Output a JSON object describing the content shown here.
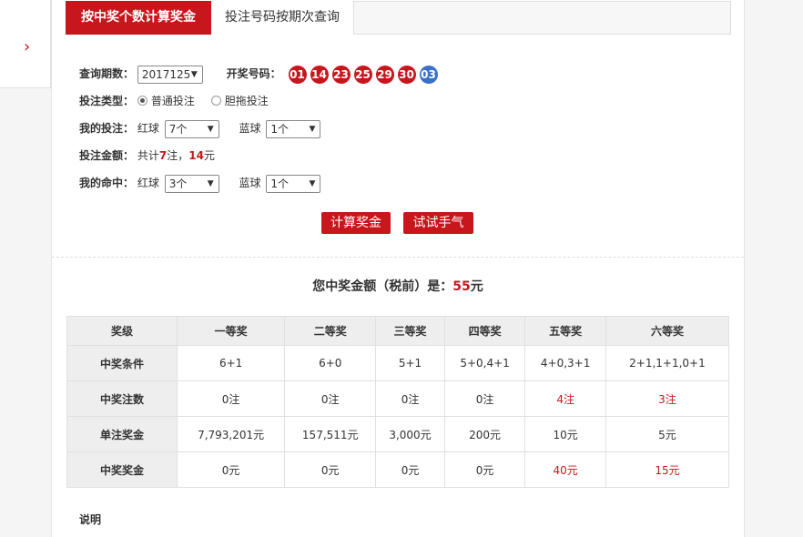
{
  "tabs": {
    "active": "按中奖个数计算奖金",
    "inactive": "投注号码按期次查询"
  },
  "query": {
    "period_label": "查询期数：",
    "period_value": "2017125",
    "winning_label": "开奖号码：",
    "red_balls": [
      "01",
      "14",
      "23",
      "25",
      "29",
      "30"
    ],
    "blue_balls": [
      "03"
    ]
  },
  "bet_type": {
    "label": "投注类型：",
    "options": [
      "普通投注",
      "胆拖投注"
    ],
    "selected": "普通投注"
  },
  "my_bet": {
    "label": "我的投注：",
    "red_label": "红球",
    "red_value": "7个",
    "blue_label": "蓝球",
    "blue_value": "1个"
  },
  "amount": {
    "label": "投注金额：",
    "prefix": "共计",
    "count": "7",
    "mid": "注，",
    "money": "14",
    "suffix": "元"
  },
  "my_hit": {
    "label": "我的命中：",
    "red_label": "红球",
    "red_value": "3个",
    "blue_label": "蓝球",
    "blue_value": "1个"
  },
  "buttons": {
    "calculate": "计算奖金",
    "luck": "试试手气"
  },
  "result": {
    "prefix": "您中奖金额（税前）是：",
    "amount": "55",
    "suffix": "元"
  },
  "table": {
    "headers": [
      "奖级",
      "一等奖",
      "二等奖",
      "三等奖",
      "四等奖",
      "五等奖",
      "六等奖"
    ],
    "rows": [
      {
        "label": "中奖条件",
        "cells": [
          "6+1",
          "6+0",
          "5+1",
          "5+0,4+1",
          "4+0,3+1",
          "2+1,1+1,0+1"
        ],
        "highlight": [
          false,
          false,
          false,
          false,
          false,
          false
        ]
      },
      {
        "label": "中奖注数",
        "cells": [
          "0注",
          "0注",
          "0注",
          "0注",
          "4注",
          "3注"
        ],
        "highlight": [
          false,
          false,
          false,
          false,
          true,
          true
        ]
      },
      {
        "label": "单注奖金",
        "cells": [
          "7,793,201元",
          "157,511元",
          "3,000元",
          "200元",
          "10元",
          "5元"
        ],
        "highlight": [
          false,
          false,
          false,
          false,
          false,
          false
        ]
      },
      {
        "label": "中奖奖金",
        "cells": [
          "0元",
          "0元",
          "0元",
          "0元",
          "40元",
          "15元"
        ],
        "highlight": [
          false,
          false,
          false,
          false,
          true,
          true
        ]
      }
    ]
  },
  "explain_label": "说明",
  "colors": {
    "accent": "#c8161d",
    "blue_ball": "#3c6fc9"
  }
}
